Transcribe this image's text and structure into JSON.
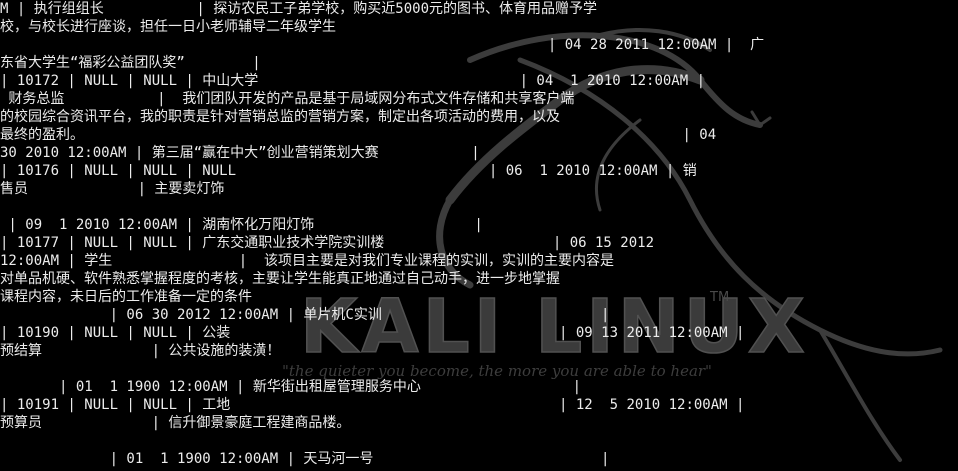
{
  "wallpaper": {
    "logo_text": "KALI LINUX",
    "trademark": "TM",
    "slogan": "\"the quieter you become, the more you are able to hear\""
  },
  "terminal": {
    "lines": [
      "M | 执行组组长           | 探访农民工子弟学校，购买近5000元的图书、体育用品赠予学",
      "校，与校长进行座谈，担任一日小老师辅导二年级学生",
      "                                                                 | 04 28 2011 12:00AM |  广",
      "东省大学生“福彩公益团队奖”        |",
      "| 10172 | NULL | NULL | 中山大学                               | 04  1 2010 12:00AM |",
      " 财务总监           |  我们团队开发的产品是基于局域网分布式文件存储和共享客户端",
      "的校园综合资讯平台，我的职责是针对营销总监的营销方案，制定出各项活动的费用，以及",
      "最终的盈利。                                                                       | 04",
      "30 2010 12:00AM | 第三届“赢在中大”创业营销策划大赛           |",
      "| 10176 | NULL | NULL | NULL                              | 06  1 2010 12:00AM | 销",
      "售员             | 主要卖灯饰",
      "",
      " | 09  1 2010 12:00AM | 湖南怀化万阳灯饰                   |",
      "| 10177 | NULL | NULL | 广东交通职业技术学院实训楼                    | 06 15 2012",
      "12:00AM | 学生               |  该项目主要是对我们专业课程的实训，实训的主要内容是",
      "对单品机硬、软件熟悉掌握程度的考核，主要让学生能真正地通过自己动手，进一步地掌握",
      "课程内容，未日后的工作准备一定的条件",
      "             | 06 30 2012 12:00AM | 单片机C实训                          |",
      "| 10190 | NULL | NULL | 公装                                       | 09 13 2011 12:00AM |",
      "预结算             | 公共设施的装潢！",
      "",
      "       | 01  1 1900 12:00AM | 新华街出租屋管理服务中心                  |",
      "| 10191 | NULL | NULL | 工地                                       | 12  5 2010 12:00AM |",
      "预算员             | 信升御景豪庭工程建商品楼。",
      "",
      "             | 01  1 1900 12:00AM | 天马河一号                           |"
    ]
  }
}
